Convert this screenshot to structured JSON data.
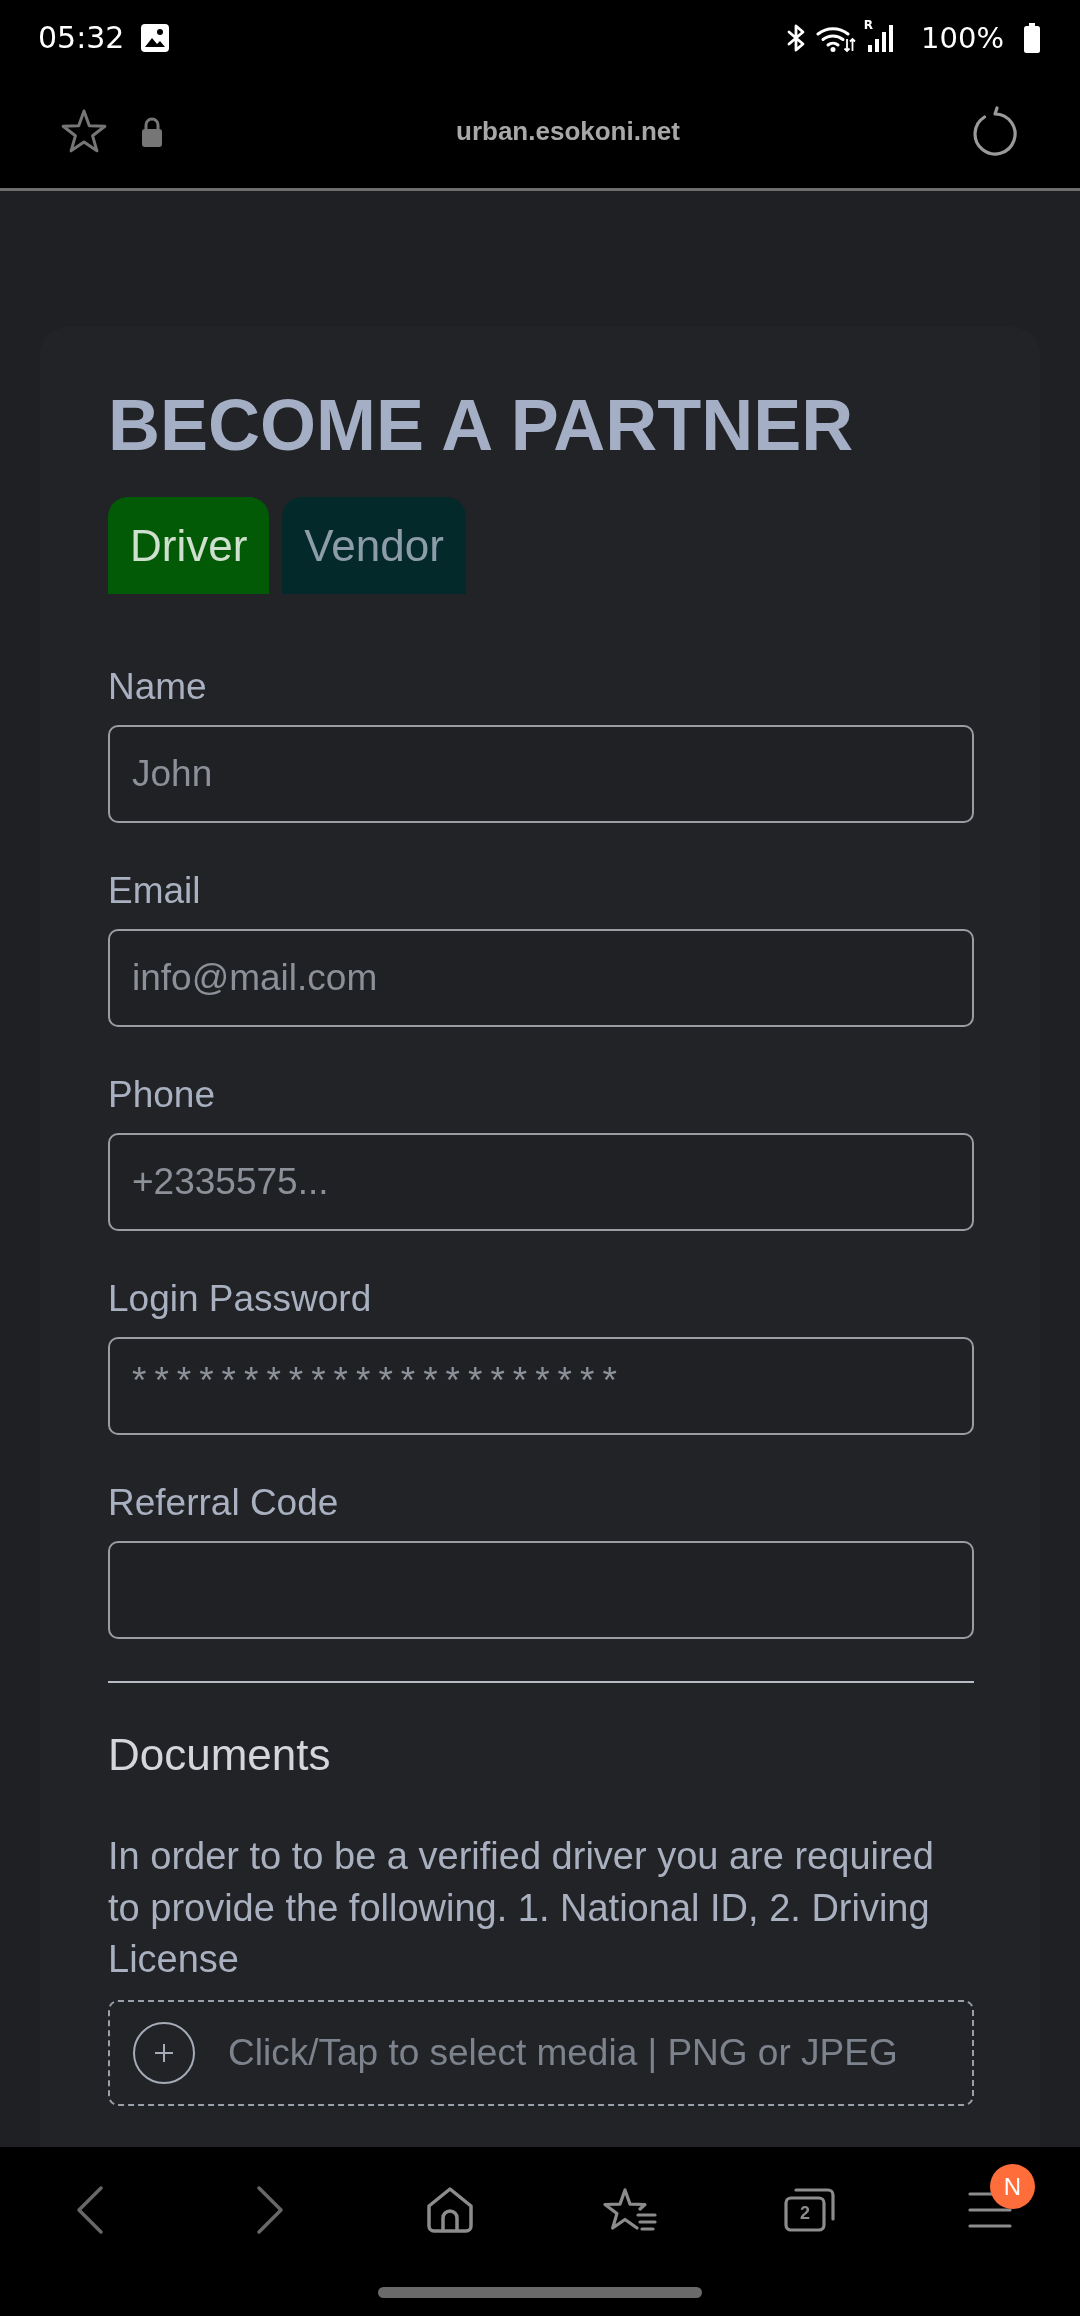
{
  "status_bar": {
    "time": "05:32",
    "network_label": "R",
    "battery": "100%"
  },
  "browser_bar": {
    "url": "urban.esokoni.net"
  },
  "page": {
    "title": "BECOME A PARTNER",
    "tabs": [
      {
        "label": "Driver",
        "selected": true
      },
      {
        "label": "Vendor",
        "selected": false
      }
    ],
    "fields": [
      {
        "label": "Name",
        "placeholder": "John",
        "kind": "text"
      },
      {
        "label": "Email",
        "placeholder": "info@mail.com",
        "kind": "text"
      },
      {
        "label": "Phone",
        "placeholder": "+2335575...",
        "kind": "text"
      },
      {
        "label": "Login Password",
        "placeholder": "**********************",
        "kind": "password"
      },
      {
        "label": "Referral Code",
        "kind": "text"
      }
    ],
    "documents": {
      "heading": "Documents",
      "description": "In order to to be a verified driver you are required to provide the following. 1. National ID, 2. Driving License",
      "upload_hint": "Click/Tap to select media | PNG or JPEG"
    }
  },
  "bottom_bar": {
    "tab_count": "2",
    "menu_badge": "N"
  }
}
